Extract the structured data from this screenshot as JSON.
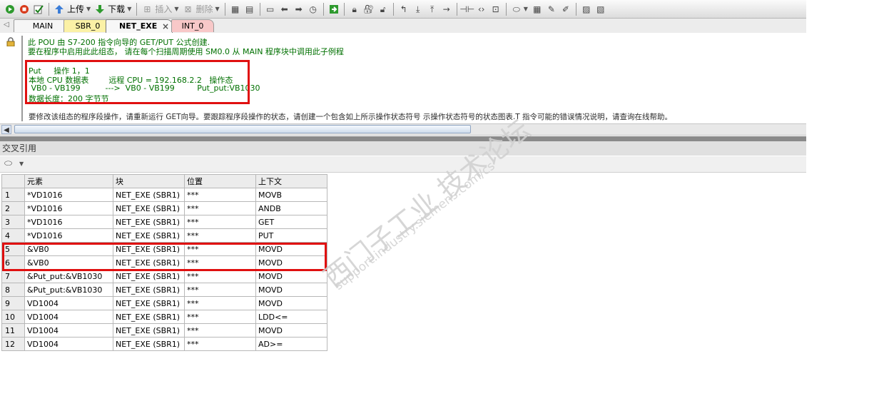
{
  "toolbar": {
    "upload_label": "上传",
    "download_label": "下载",
    "insert_label": "插入",
    "delete_label": "删除"
  },
  "tabs": [
    "MAIN",
    "SBR_0",
    "NET_EXE",
    "INT_0"
  ],
  "active_tab": "NET_EXE",
  "editor": {
    "comment_line1": "此 POU 由 S7-200 指令向导的 GET/PUT 公式创建.",
    "comment_line2": "要在程序中启用此此组态， 请在每个扫描周期使用 SM0.0 从 MAIN 程序块中调用此子例程",
    "op_line1": "Put     操作 1，1",
    "op_line2": "本地 CPU 数据表        远程 CPU = 192.168.2.2   操作态",
    "op_line3": " VB0 - VB199          --->  VB0 - VB199         Put_put:VB1030",
    "op_line4": "数据长度：200 字节节",
    "footer_note": "要修改该组态的程序段操作，请重新运行 GET向导。要跟踪程序段操作的状态，请创建一个包含如上所示操作状态符号 示操作状态符号的状态图表.T 指令可能的错误情况说明，请查询在线帮助。"
  },
  "cross_ref": {
    "title": "交叉引用",
    "columns": [
      "",
      "元素",
      "块",
      "位置",
      "上下文"
    ],
    "rows": [
      [
        "1",
        "*VD1016",
        "NET_EXE (SBR1)",
        "***",
        "MOVB"
      ],
      [
        "2",
        "*VD1016",
        "NET_EXE (SBR1)",
        "***",
        "ANDB"
      ],
      [
        "3",
        "*VD1016",
        "NET_EXE (SBR1)",
        "***",
        "GET"
      ],
      [
        "4",
        "*VD1016",
        "NET_EXE (SBR1)",
        "***",
        "PUT"
      ],
      [
        "5",
        "&VB0",
        "NET_EXE (SBR1)",
        "***",
        "MOVD"
      ],
      [
        "6",
        "&VB0",
        "NET_EXE (SBR1)",
        "***",
        "MOVD"
      ],
      [
        "7",
        "&Put_put:&VB1030",
        "NET_EXE (SBR1)",
        "***",
        "MOVD"
      ],
      [
        "8",
        "&Put_put:&VB1030",
        "NET_EXE (SBR1)",
        "***",
        "MOVD"
      ],
      [
        "9",
        "VD1004",
        "NET_EXE (SBR1)",
        "***",
        "MOVD"
      ],
      [
        "10",
        "VD1004",
        "NET_EXE (SBR1)",
        "***",
        "LDD<="
      ],
      [
        "11",
        "VD1004",
        "NET_EXE (SBR1)",
        "***",
        "MOVD"
      ],
      [
        "12",
        "VD1004",
        "NET_EXE (SBR1)",
        "***",
        "AD>="
      ]
    ]
  },
  "watermark": {
    "cn": "西门子工业  技术论坛",
    "url": "support.industry.siemens.com/cs"
  },
  "colors": {
    "highlight_red": "#e01010",
    "comment_green": "#007000"
  }
}
